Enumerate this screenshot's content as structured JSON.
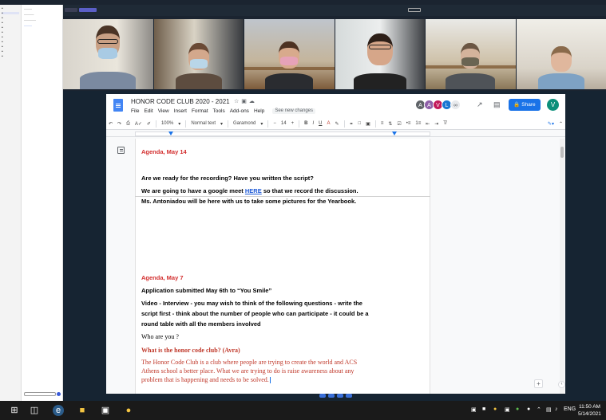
{
  "doc": {
    "title": "HONOR CODE CLUB 2020 - 2021",
    "see_changes": "See new changes",
    "menu": [
      "File",
      "Edit",
      "View",
      "Insert",
      "Format",
      "Tools",
      "Add-ons",
      "Help"
    ],
    "share_label": "Share",
    "user_initial": "V",
    "collaborators": [
      {
        "initial": "A",
        "color": "#5f6368"
      },
      {
        "initial": "A",
        "color": "#8e5fa8"
      },
      {
        "initial": "V",
        "color": "#c2185b"
      },
      {
        "initial": "L",
        "color": "#1976d2"
      }
    ],
    "toolbar": {
      "zoom": "100%",
      "style": "Normal text",
      "font": "Garamond",
      "size": "14"
    },
    "content": {
      "agenda1": "Agenda, May 14",
      "q1": "Are we ready for the recording? Have you written the script?",
      "meet_pre": "We are going to have a google meet ",
      "meet_link": "HERE",
      "meet_post": " so that we record the discussion.",
      "antoniadou": "Ms. Antoniadou will be here with us to take some pictures for the Yearbook.",
      "agenda2": "Agenda, May 7",
      "application": "Application submitted May 6th to “You Smile”",
      "video1": "Video - Interview - you may wish to think of the following questions - write the",
      "video2": "script first - think about the number of people who can participate - it could be a",
      "video3": "round table with all the members involved",
      "who": "Who are you ?",
      "what": "What is the honor code club? (Avra)",
      "p1": "The Honor Code Club is a club where people are trying to create the world and ACS",
      "p2": "Athens school a better place. What we are trying to do is raise awareness about any",
      "p3": "problem that is happening and needs to be solved."
    }
  },
  "taskbar": {
    "lang": "ENG",
    "time": "11:50 AM",
    "date": "5/14/2021"
  }
}
